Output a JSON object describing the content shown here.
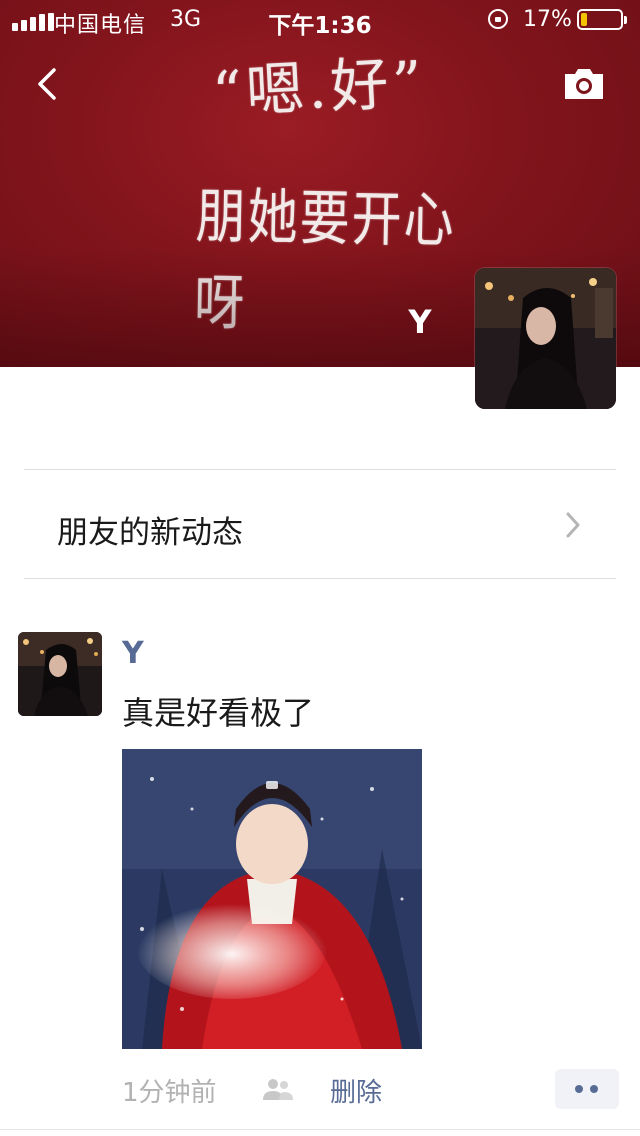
{
  "status_bar": {
    "carrier": "中国电信",
    "network": "3G",
    "time": "下午1:36",
    "battery_percent": "17%",
    "battery_level": 0.17,
    "battery_color": "#f5c400"
  },
  "cover": {
    "handwriting_line1": "“嗯.好”",
    "handwriting_line2": "朋她要开心呀",
    "username": "Y",
    "background_color": "#82141c"
  },
  "nav": {
    "back_icon": "chevron-left",
    "camera_icon": "camera"
  },
  "updates": {
    "label": "朋友的新动态",
    "icon": "chevron-right"
  },
  "post": {
    "author": "Y",
    "text": "真是好看极了",
    "time": "1分钟前",
    "visibility_icon": "people-group",
    "delete_label": "删除",
    "more_icon": "two-dots",
    "link_color": "#576b95"
  }
}
